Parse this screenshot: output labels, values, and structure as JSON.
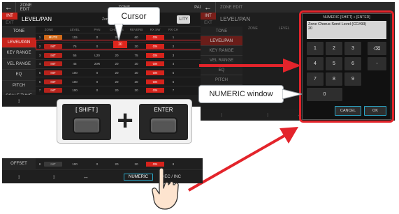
{
  "left_screen": {
    "title": "ZONE EDIT",
    "title_right": "ZONE",
    "title_right2": "PAD",
    "header_label": "LEVEL/PAN",
    "zone_label": "Zone",
    "utility_label": "LITY",
    "int_label": "INT",
    "ext_label": "EXT",
    "columns": [
      "ZONE",
      "LEVEL",
      "PAN",
      "CHORUS",
      "REVERB",
      "RX SW",
      "RX CH"
    ],
    "sidebar": [
      "TONE",
      "LEVEL/PAN",
      "KEY RANGE",
      "VEL RANGE",
      "EQ",
      "PITCH",
      "SCALE TUNE",
      "VIBRATO",
      "OFFSET"
    ],
    "rows": [
      {
        "zone": "1",
        "tag": "MUTE",
        "level": "115",
        "pan": "0",
        "chorus": "20",
        "reverb": "60",
        "sw": "ON",
        "ch": "1"
      },
      {
        "zone": "2",
        "tag": "INT",
        "level": "75",
        "pan": "0",
        "chorus": "20",
        "reverb": "20",
        "sw": "ON",
        "ch": "2"
      },
      {
        "zone": "3",
        "tag": "INT",
        "level": "55",
        "pan": "L20",
        "chorus": "20",
        "reverb": "75",
        "sw": "ON",
        "ch": "3"
      },
      {
        "zone": "4",
        "tag": "INT",
        "level": "45",
        "pan": "20R",
        "chorus": "20",
        "reverb": "20",
        "sw": "ON",
        "ch": "4"
      },
      {
        "zone": "5",
        "tag": "INT",
        "level": "100",
        "pan": "0",
        "chorus": "20",
        "reverb": "20",
        "sw": "ON",
        "ch": "5"
      },
      {
        "zone": "6",
        "tag": "INT",
        "level": "100",
        "pan": "0",
        "chorus": "20",
        "reverb": "20",
        "sw": "ON",
        "ch": "6"
      },
      {
        "zone": "7",
        "tag": "INT",
        "level": "100",
        "pan": "0",
        "chorus": "20",
        "reverb": "20",
        "sw": "ON",
        "ch": "7"
      },
      {
        "zone": "8",
        "tag": "INT",
        "level": "100",
        "pan": "0",
        "chorus": "20",
        "reverb": "20",
        "sw": "ON",
        "ch": "8"
      }
    ],
    "footer": [
      "↕",
      "↕"
    ]
  },
  "cursor_callout": "Cursor",
  "combo": {
    "shift": "[ SHIFT ]",
    "plus": "+",
    "enter": "ENTER"
  },
  "bottom_strip": {
    "label": "OFFSET",
    "zone": "8",
    "tag": "INT",
    "level": "100",
    "pan": "0",
    "chorus": "20",
    "reverb": "20",
    "sw": "ON",
    "ch": "8",
    "numeric_btn": "NUMERIC",
    "dec_inc": "DEC / INC",
    "arrows": [
      "↕",
      "↕",
      "↔"
    ]
  },
  "right_screen": {
    "title": "ZONE EDIT",
    "int_label": "INT",
    "ext_label": "EXT",
    "header_label": "LEVEL/PAN",
    "sidebar": [
      "TONE",
      "LEVEL/PAN",
      "KEY RANGE",
      "VEL RANGE",
      "EQ",
      "PITCH",
      "SCALE TUNE"
    ],
    "col_zone": "ZONE",
    "col_level": "LEVEL",
    "footer": [
      "↕",
      "↕",
      "↔"
    ]
  },
  "numeric_window": {
    "header": "NUMERIC [SHIFT] + [ENTER]",
    "param": "Zone Chorus Send Level (CC#93)",
    "value": "20",
    "keys": [
      "1",
      "2",
      "3",
      "4",
      "5",
      "6",
      "7",
      "8",
      "9",
      "0"
    ],
    "minus": "-",
    "cancel": "CANCEL",
    "ok": "OK"
  },
  "numeric_callout": "NUMERIC window",
  "colors": {
    "accent_red": "#e3242b",
    "screen_bg": "#1a1a1a"
  }
}
